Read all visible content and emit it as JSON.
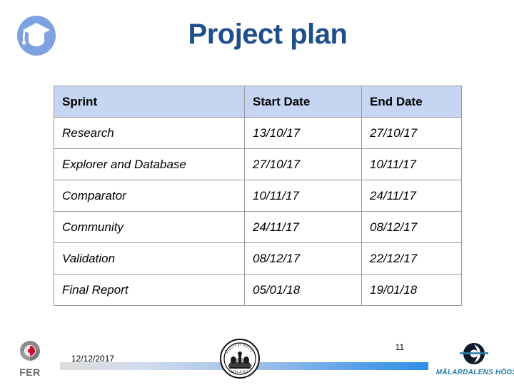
{
  "slide": {
    "title": "Project plan",
    "title_color": "#1F4E8C",
    "header_icon": "graduation-cap-icon"
  },
  "table": {
    "header_bg": "#C6D5F1",
    "columns": [
      "Sprint",
      "Start Date",
      "End Date"
    ],
    "rows": [
      {
        "sprint": "Research",
        "start": "13/10/17",
        "end": "27/10/17"
      },
      {
        "sprint": "Explorer and Database",
        "start": "27/10/17",
        "end": "10/11/17"
      },
      {
        "sprint": "Comparator",
        "start": "10/11/17",
        "end": "24/11/17"
      },
      {
        "sprint": "Community",
        "start": "24/11/17",
        "end": "08/12/17"
      },
      {
        "sprint": "Validation",
        "start": "08/12/17",
        "end": "22/12/17"
      },
      {
        "sprint": "Final Report",
        "start": "05/01/18",
        "end": "19/01/18"
      }
    ]
  },
  "footer": {
    "date": "12/12/2017",
    "page_number": "11",
    "left_logo_text": "FER",
    "center_logo": "politecnico-di-milano-seal",
    "center_logo_text": "MILANO",
    "right_logo_text": "MÄLARDALENS HÖGSKOLA",
    "right_logo_color": "#1F7FA8",
    "bar_gradient_from": "#dcdcdc",
    "bar_gradient_to": "#2f8fe8"
  }
}
